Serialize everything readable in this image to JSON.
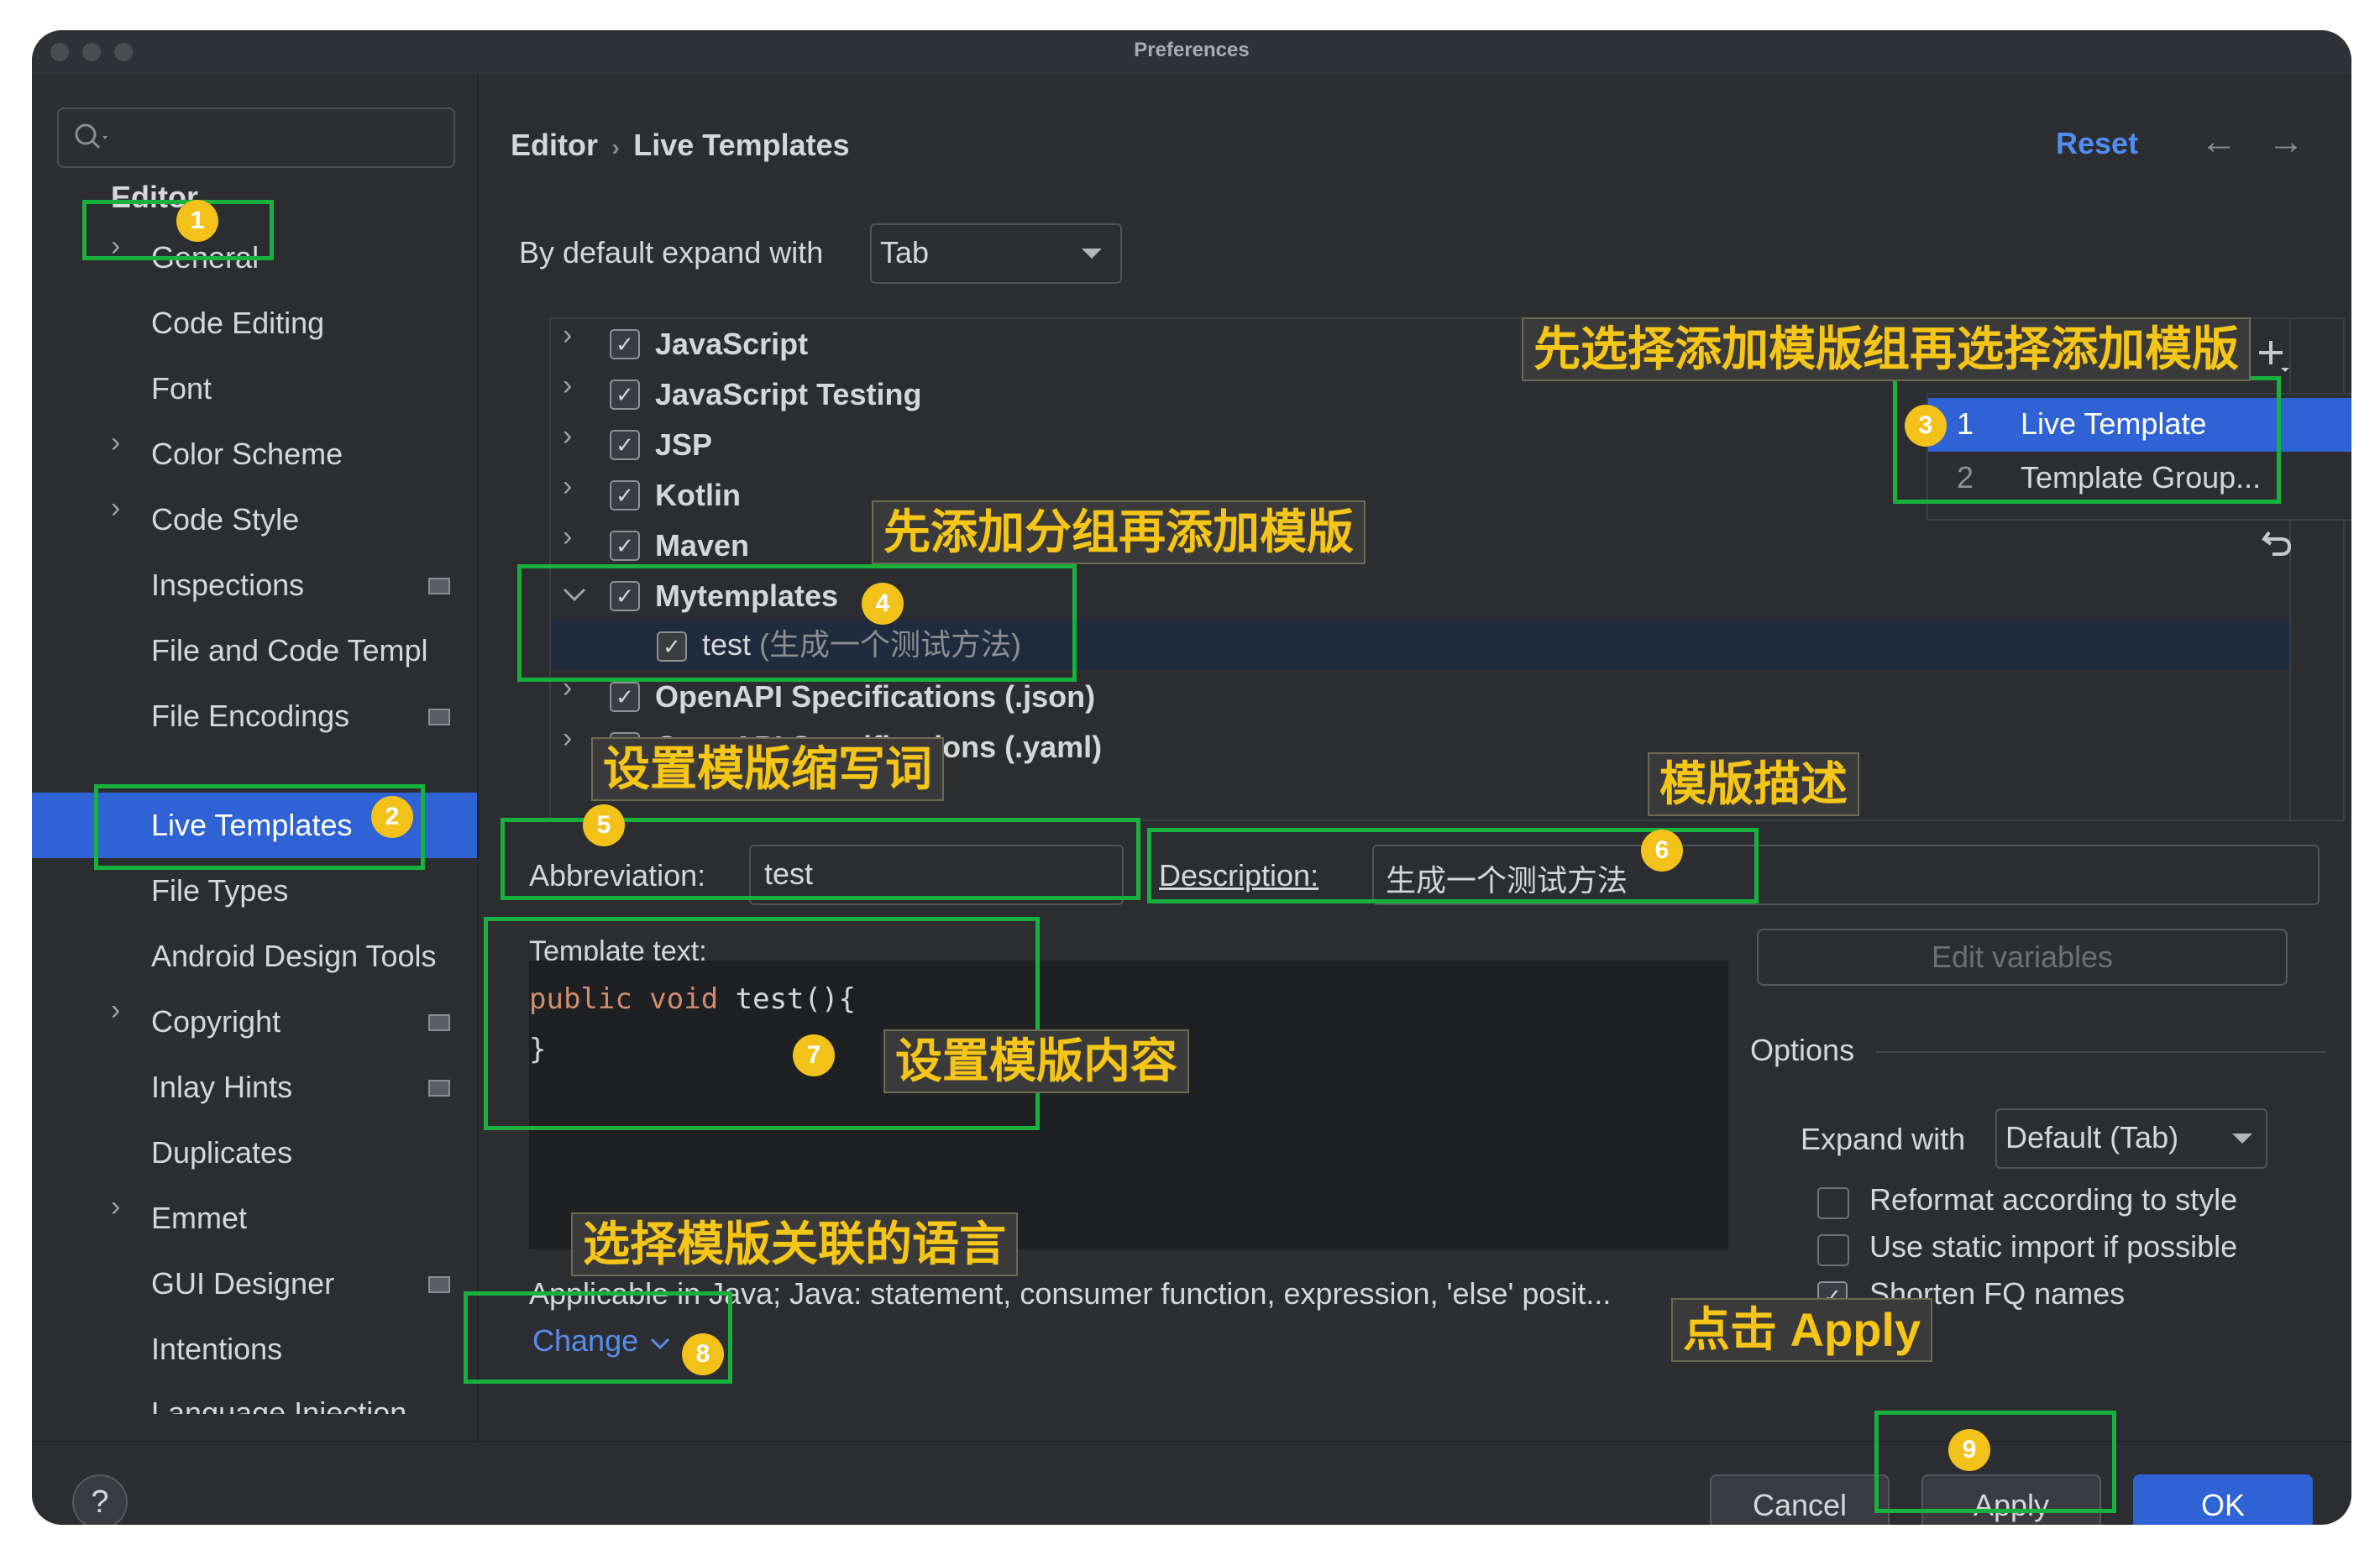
{
  "window": {
    "title": "Preferences"
  },
  "sidebar": {
    "root": "Editor",
    "items": [
      {
        "label": "General"
      },
      {
        "label": "Code Editing"
      },
      {
        "label": "Font"
      },
      {
        "label": "Color Scheme"
      },
      {
        "label": "Code Style"
      },
      {
        "label": "Inspections"
      },
      {
        "label": "File and Code Templ"
      },
      {
        "label": "File Encodings"
      },
      {
        "label": "Live Templates"
      },
      {
        "label": "File Types"
      },
      {
        "label": "Android Design Tools"
      },
      {
        "label": "Copyright"
      },
      {
        "label": "Inlay Hints"
      },
      {
        "label": "Duplicates"
      },
      {
        "label": "Emmet"
      },
      {
        "label": "GUI Designer"
      },
      {
        "label": "Intentions"
      },
      {
        "label": "Language Injection"
      }
    ]
  },
  "header": {
    "crumb_parent": "Editor",
    "crumb_sep": "›",
    "crumb_current": "Live Templates",
    "reset": "Reset",
    "back": "←",
    "forward": "→"
  },
  "expand": {
    "label": "By default expand with",
    "value": "Tab"
  },
  "tree": {
    "groups": [
      {
        "label": "JavaScript"
      },
      {
        "label": "JavaScript Testing"
      },
      {
        "label": "JSP"
      },
      {
        "label": "Kotlin"
      },
      {
        "label": "Maven"
      },
      {
        "label": "Mytemplates"
      },
      {
        "label": "test",
        "desc": "(生成一个测试方法)"
      },
      {
        "label": "OpenAPI Specifications (.json)"
      },
      {
        "label": "OpenAPI Specifications (.yaml)"
      }
    ]
  },
  "add_menu": {
    "items": [
      {
        "num": "1",
        "label": "Live Template"
      },
      {
        "num": "2",
        "label": "Template Group..."
      }
    ]
  },
  "abbreviation": {
    "label": "Abbreviation:",
    "value": "test"
  },
  "description": {
    "label": "Description:",
    "value": "生成一个测试方法"
  },
  "template": {
    "label": "Template text:",
    "line1_kw": "public void",
    "line1_rest": " test(){",
    "line2": "}"
  },
  "edit_variables": "Edit variables",
  "options": {
    "title": "Options",
    "expand_label": "Expand with",
    "expand_value": "Default (Tab)",
    "reformat": "Reformat according to style",
    "static_import": "Use static import if possible",
    "shorten": "Shorten FQ names"
  },
  "applicable": {
    "text": "Applicable in Java; Java: statement, consumer function, expression, 'else' posit...",
    "change": "Change"
  },
  "footer": {
    "help": "?",
    "cancel": "Cancel",
    "apply": "Apply",
    "ok": "OK"
  },
  "annotations": {
    "n1": "1",
    "n2": "2",
    "n3": "3",
    "n4": "4",
    "n5": "5",
    "n6": "6",
    "n7": "7",
    "n8": "8",
    "n9": "9",
    "note_group_first": "先选择添加模版组再选择添加模版",
    "note_add_group": "先添加分组再添加模版",
    "note_abbrev": "设置模版缩写词",
    "note_desc": "模版描述",
    "note_content": "设置模版内容",
    "note_lang": "选择模版关联的语言",
    "note_apply": "点击 Apply"
  },
  "colors": {
    "accent": "#2f62d5",
    "keyword": "#cf8e6d",
    "annotation_box": "#19b13d",
    "note_text": "#f5c518",
    "badge": "#f2c21b"
  }
}
